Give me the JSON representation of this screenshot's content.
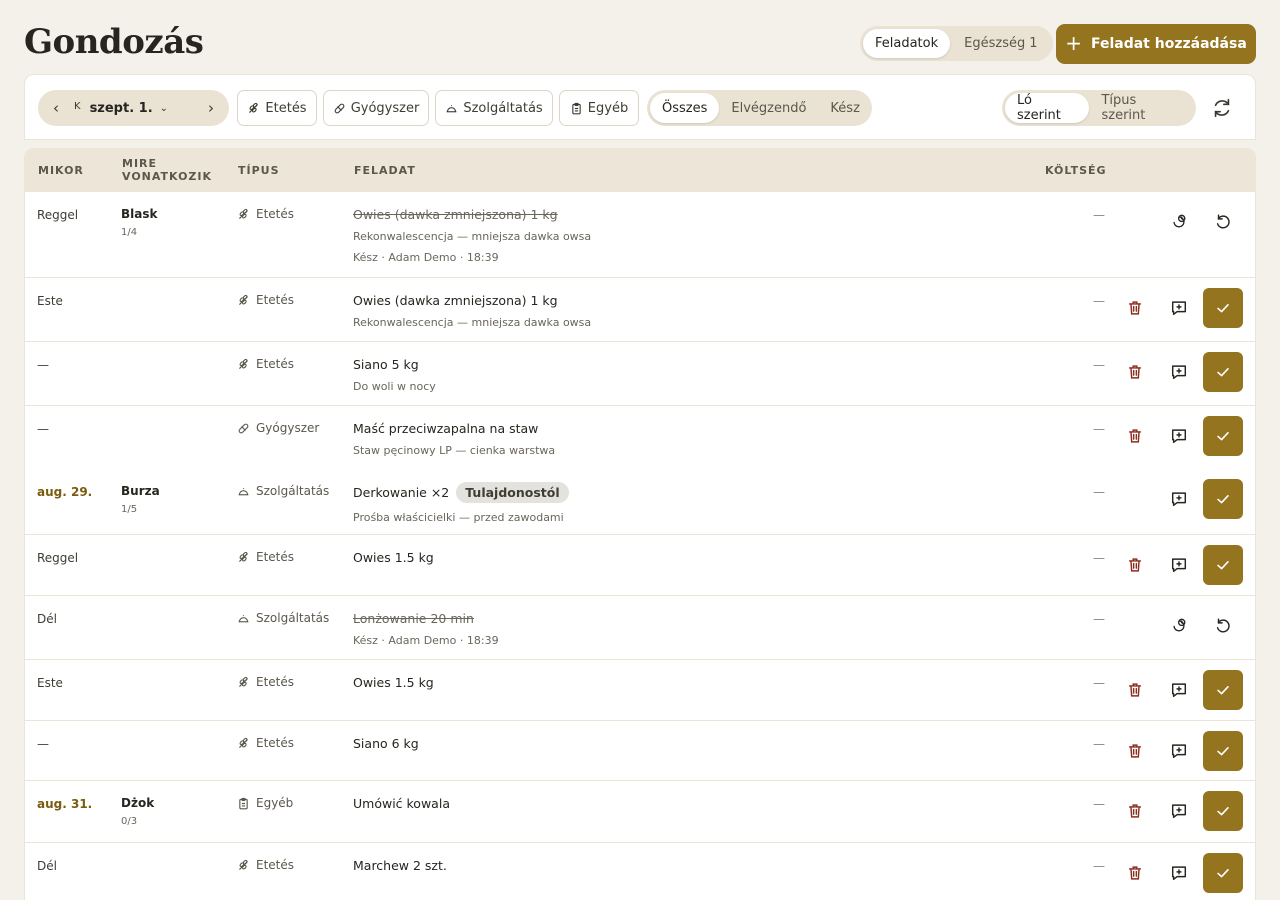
{
  "header": {
    "title": "Gondozás",
    "view_tabs": [
      {
        "label": "Feladatok",
        "active": true
      },
      {
        "label": "Egészség",
        "badge": "1",
        "active": false
      }
    ],
    "add_button": "Feladat hozzáadása"
  },
  "toolbar": {
    "date_key": "K",
    "date_label": "szept. 1.",
    "type_filters": [
      "Etetés",
      "Gyógyszer",
      "Szolgáltatás",
      "Egyéb"
    ],
    "status_filters": [
      "Összes",
      "Elvégzendő",
      "Kész"
    ],
    "group_options": [
      "Ló szerint",
      "Típus szerint"
    ]
  },
  "columns": [
    "MIKOR",
    "MIRE VONATKOZIK",
    "TÍPUS",
    "FELADAT",
    "KÖLTSÉG"
  ],
  "rows": [
    {
      "when": "Reggel",
      "horse": "Blask",
      "horse_sub": "1/4",
      "type": "Etetés",
      "title": "Owies (dawka zmniejszona) 1 kg",
      "note": "Rekonwalescencja — mniejsza dawka owsa",
      "meta": "Kész · Adam Demo · 18:39",
      "cost": "—",
      "done": true
    },
    {
      "when": "Este",
      "horse": "",
      "horse_sub": "",
      "type": "Etetés",
      "title": "Owies (dawka zmniejszona) 1 kg",
      "note": "Rekonwalescencja — mniejsza dawka owsa",
      "meta": "",
      "cost": "—",
      "done": false
    },
    {
      "when": "—",
      "horse": "",
      "horse_sub": "",
      "type": "Etetés",
      "title": "Siano 5 kg",
      "note": "Do woli w nocy",
      "meta": "",
      "cost": "—",
      "done": false
    },
    {
      "when": "—",
      "horse": "",
      "horse_sub": "",
      "type": "Gyógyszer",
      "title": "Maść przeciwzapalna na staw",
      "note": "Staw pęcinowy LP — cienka warstwa",
      "meta": "",
      "cost": "—",
      "done": false
    },
    {
      "when": "aug. 29.",
      "horse": "Burza",
      "horse_sub": "1/5",
      "type": "Szolgáltatás",
      "title": "Derkowanie ×2",
      "tag": "Tulajdonostól",
      "note": "Prośba właścicielki — przed zawodami",
      "meta": "",
      "cost": "—",
      "done": false
    },
    {
      "when": "Reggel",
      "horse": "",
      "horse_sub": "",
      "type": "Etetés",
      "title": "Owies 1.5 kg",
      "note": "",
      "meta": "",
      "cost": "—",
      "done": false
    },
    {
      "when": "Dél",
      "horse": "",
      "horse_sub": "",
      "type": "Szolgáltatás",
      "title": "Lonżowanie 20 min",
      "note": "",
      "meta": "Kész · Adam Demo · 18:39",
      "cost": "—",
      "done": true
    },
    {
      "when": "Este",
      "horse": "",
      "horse_sub": "",
      "type": "Etetés",
      "title": "Owies 1.5 kg",
      "note": "",
      "meta": "",
      "cost": "—",
      "done": false
    },
    {
      "when": "—",
      "horse": "",
      "horse_sub": "",
      "type": "Etetés",
      "title": "Siano 6 kg",
      "note": "",
      "meta": "",
      "cost": "—",
      "done": false
    },
    {
      "when": "aug. 31.",
      "horse": "Dżok",
      "horse_sub": "0/3",
      "type": "Egyéb",
      "title": "Umówić kowala",
      "note": "",
      "meta": "",
      "cost": "—",
      "done": false
    },
    {
      "when": "Dél",
      "horse": "",
      "horse_sub": "",
      "type": "Etetés",
      "title": "Marchew 2 szt.",
      "note": "",
      "meta": "",
      "cost": "—",
      "done": false
    }
  ],
  "icons": {
    "Etetés": "grain-icon",
    "Gyógyszer": "pill-icon",
    "Szolgáltatás": "service-bell-icon",
    "Egyéb": "clipboard-icon"
  },
  "colors": {
    "accent": "#94741f",
    "date_text": "#7a5c10",
    "delete_icon": "#8b2e1f",
    "background": "#f4f1ea",
    "header_bg": "#ede5d7"
  }
}
